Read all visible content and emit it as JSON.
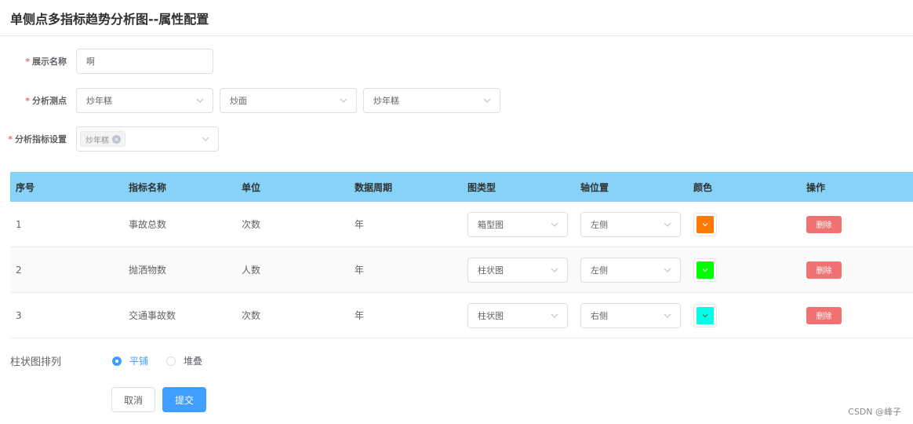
{
  "header": {
    "title": "单侧点多指标趋势分析图--属性配置"
  },
  "form": {
    "required_mark": "*",
    "display_name": {
      "label": "展示名称",
      "value": "啊"
    },
    "analysis_points": {
      "label": "分析测点",
      "selects": [
        "炒年糕",
        "炒面",
        "炒年糕"
      ]
    },
    "indicator_settings": {
      "label": "分析指标设置",
      "tag": "炒年糕"
    }
  },
  "table": {
    "headers": [
      "序号",
      "指标名称",
      "单位",
      "数据周期",
      "图类型",
      "轴位置",
      "颜色",
      "操作"
    ],
    "rows": [
      {
        "index": "1",
        "name": "事故总数",
        "unit": "次数",
        "period": "年",
        "chart_type": "箱型图",
        "axis": "左侧",
        "color": "#ff7a00",
        "action": "删除"
      },
      {
        "index": "2",
        "name": "抛洒物数",
        "unit": "人数",
        "period": "年",
        "chart_type": "柱状图",
        "axis": "左侧",
        "color": "#00ff00",
        "action": "删除"
      },
      {
        "index": "3",
        "name": "交通事故数",
        "unit": "次数",
        "period": "年",
        "chart_type": "柱状图",
        "axis": "右侧",
        "color": "#00ffe6",
        "action": "删除"
      }
    ]
  },
  "bar_arrangement": {
    "label": "柱状图排列",
    "options": [
      {
        "label": "平铺",
        "checked": true
      },
      {
        "label": "堆叠",
        "checked": false
      }
    ]
  },
  "buttons": {
    "cancel": "取消",
    "submit": "提交"
  },
  "watermark": "CSDN @峰子",
  "colors": {
    "accent": "#409eff",
    "table_header": "#87d3f8",
    "delete": "#f07272"
  }
}
